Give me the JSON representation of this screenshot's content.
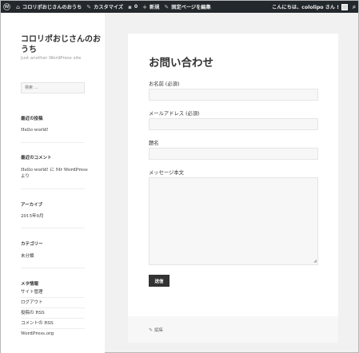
{
  "adminbar": {
    "site_name": "コロリポおじさんのおうち",
    "customize": "カスタマイズ",
    "comments_count": "0",
    "new": "新規",
    "edit_page": "固定ページを編集",
    "greeting": "こんにちは、cololipo さん !"
  },
  "sidebar": {
    "site_title": "コロリポおじさんのおうち",
    "site_description": "Just another WordPress site",
    "search_placeholder": "検索 …",
    "recent_posts_title": "最近の投稿",
    "recent_post_1": "Hello world!",
    "recent_comments_title": "最近のコメント",
    "recent_comment_1": "Hello world! に Mr WordPress より",
    "archives_title": "アーカイブ",
    "archive_1": "2015年9月",
    "categories_title": "カテゴリー",
    "category_1": "未分類",
    "meta_title": "メタ情報",
    "meta_items": [
      "サイト管理",
      "ログアウト",
      "投稿の RSS",
      "コメントの RSS",
      "WordPress.org"
    ]
  },
  "main": {
    "title": "お問い合わせ",
    "name_label": "お名前 (必須)",
    "email_label": "メールアドレス (必須)",
    "subject_label": "題名",
    "message_label": "メッセージ本文",
    "submit_label": "送信",
    "edit_label": "編集"
  },
  "colors": {
    "adminbar_bg": "#23282d",
    "page_bg": "#f1f1f1",
    "button_bg": "#333333"
  }
}
